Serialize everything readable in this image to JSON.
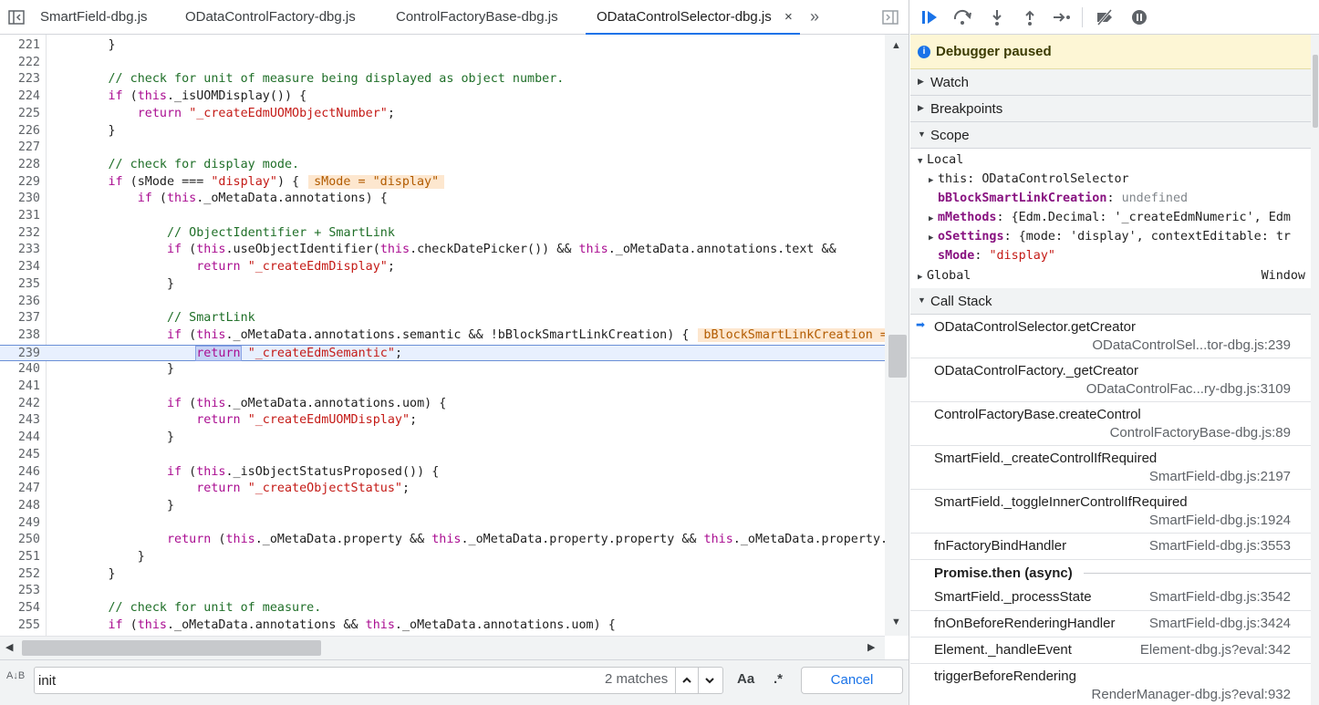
{
  "tabs": [
    {
      "label": "SmartField-dbg.js"
    },
    {
      "label": "ODataControlFactory-dbg.js"
    },
    {
      "label": "ControlFactoryBase-dbg.js"
    },
    {
      "label": "ODataControlSelector-dbg.js",
      "active": true
    }
  ],
  "tab_close_glyph": "×",
  "tab_more_glyph": "»",
  "editor": {
    "paused_line": "239",
    "lines": [
      {
        "n": "221",
        "code": "        }"
      },
      {
        "n": "222",
        "code": ""
      },
      {
        "n": "223",
        "code": "        // check for unit of measure being displayed as object number."
      },
      {
        "n": "224",
        "code": "        if (this._isUOMDisplay()) {"
      },
      {
        "n": "225",
        "code": "            return \"_createEdmUOMObjectNumber\";"
      },
      {
        "n": "226",
        "code": "        }"
      },
      {
        "n": "227",
        "code": ""
      },
      {
        "n": "228",
        "code": "        // check for display mode."
      },
      {
        "n": "229",
        "code": "        if (sMode === \"display\") {",
        "inline": "sMode = \"display\""
      },
      {
        "n": "230",
        "code": "            if (this._oMetaData.annotations) {"
      },
      {
        "n": "231",
        "code": ""
      },
      {
        "n": "232",
        "code": "                // ObjectIdentifier + SmartLink"
      },
      {
        "n": "233",
        "code": "                if (this.useObjectIdentifier(this.checkDatePicker()) && this._oMetaData.annotations.text &&"
      },
      {
        "n": "234",
        "code": "                    return \"_createEdmDisplay\";"
      },
      {
        "n": "235",
        "code": "                }"
      },
      {
        "n": "236",
        "code": ""
      },
      {
        "n": "237",
        "code": "                // SmartLink"
      },
      {
        "n": "238",
        "code": "                if (this._oMetaData.annotations.semantic && !bBlockSmartLinkCreation) {",
        "inline": "bBlockSmartLinkCreation = undefined"
      },
      {
        "n": "239",
        "code": "                    return \"_createEdmSemantic\";"
      },
      {
        "n": "240",
        "code": "                }"
      },
      {
        "n": "241",
        "code": ""
      },
      {
        "n": "242",
        "code": "                if (this._oMetaData.annotations.uom) {"
      },
      {
        "n": "243",
        "code": "                    return \"_createEdmUOMDisplay\";"
      },
      {
        "n": "244",
        "code": "                }"
      },
      {
        "n": "245",
        "code": ""
      },
      {
        "n": "246",
        "code": "                if (this._isObjectStatusProposed()) {"
      },
      {
        "n": "247",
        "code": "                    return \"_createObjectStatus\";"
      },
      {
        "n": "248",
        "code": "                }"
      },
      {
        "n": "249",
        "code": ""
      },
      {
        "n": "250",
        "code": "                return (this._oMetaData.property && this._oMetaData.property.property && this._oMetaData.property.property"
      },
      {
        "n": "251",
        "code": "            }"
      },
      {
        "n": "252",
        "code": "        }"
      },
      {
        "n": "253",
        "code": ""
      },
      {
        "n": "254",
        "code": "        // check for unit of measure."
      },
      {
        "n": "255",
        "code": "        if (this._oMetaData.annotations && this._oMetaData.annotations.uom) {"
      }
    ]
  },
  "search": {
    "value": "init",
    "match_count": "2 matches",
    "case_label": "Aa",
    "regex_label": ".*",
    "cancel_label": "Cancel",
    "replace_toggle": "A↓B"
  },
  "debugger": {
    "paused_text": "Debugger paused",
    "sections": {
      "watch": "Watch",
      "breakpoints": "Breakpoints",
      "scope": "Scope",
      "call_stack": "Call Stack"
    },
    "scope": {
      "local_label": "Local",
      "entries": [
        {
          "key": "this",
          "value": "ODataControlSelector",
          "expandable": true,
          "plain": true
        },
        {
          "key": "bBlockSmartLinkCreation",
          "value": "undefined",
          "expandable": false,
          "kind": "undef"
        },
        {
          "key": "mMethods",
          "value": "{Edm.Decimal: '_createEdmNumeric', Edm",
          "expandable": true
        },
        {
          "key": "oSettings",
          "value": "{mode: 'display', contextEditable: tr",
          "expandable": true
        },
        {
          "key": "sMode",
          "value": "\"display\"",
          "expandable": false,
          "kind": "str"
        }
      ],
      "global_label": "Global",
      "global_value": "Window"
    },
    "call_stack": [
      {
        "fn": "ODataControlSelector.getCreator",
        "loc": "ODataControlSel...tor-dbg.js:239",
        "current": true,
        "twoline": true
      },
      {
        "fn": "ODataControlFactory._getCreator",
        "loc": "ODataControlFac...ry-dbg.js:3109",
        "twoline": true
      },
      {
        "fn": "ControlFactoryBase.createControl",
        "loc": "ControlFactoryBase-dbg.js:89",
        "twoline": true
      },
      {
        "fn": "SmartField._createControlIfRequired",
        "loc": "SmartField-dbg.js:2197",
        "twoline": true
      },
      {
        "fn": "SmartField._toggleInnerControlIfRequired",
        "loc": "SmartField-dbg.js:1924",
        "twoline": true
      },
      {
        "fn": "fnFactoryBindHandler",
        "loc": "SmartField-dbg.js:3553",
        "twoline": false
      },
      {
        "async": "Promise.then (async)"
      },
      {
        "fn": "SmartField._processState",
        "loc": "SmartField-dbg.js:3542",
        "twoline": false
      },
      {
        "fn": "fnOnBeforeRenderingHandler",
        "loc": "SmartField-dbg.js:3424",
        "twoline": false
      },
      {
        "fn": "Element._handleEvent",
        "loc": "Element-dbg.js?eval:342",
        "twoline": false
      },
      {
        "fn": "triggerBeforeRendering",
        "loc": "RenderManager-dbg.js?eval:932",
        "twoline": true
      }
    ]
  }
}
